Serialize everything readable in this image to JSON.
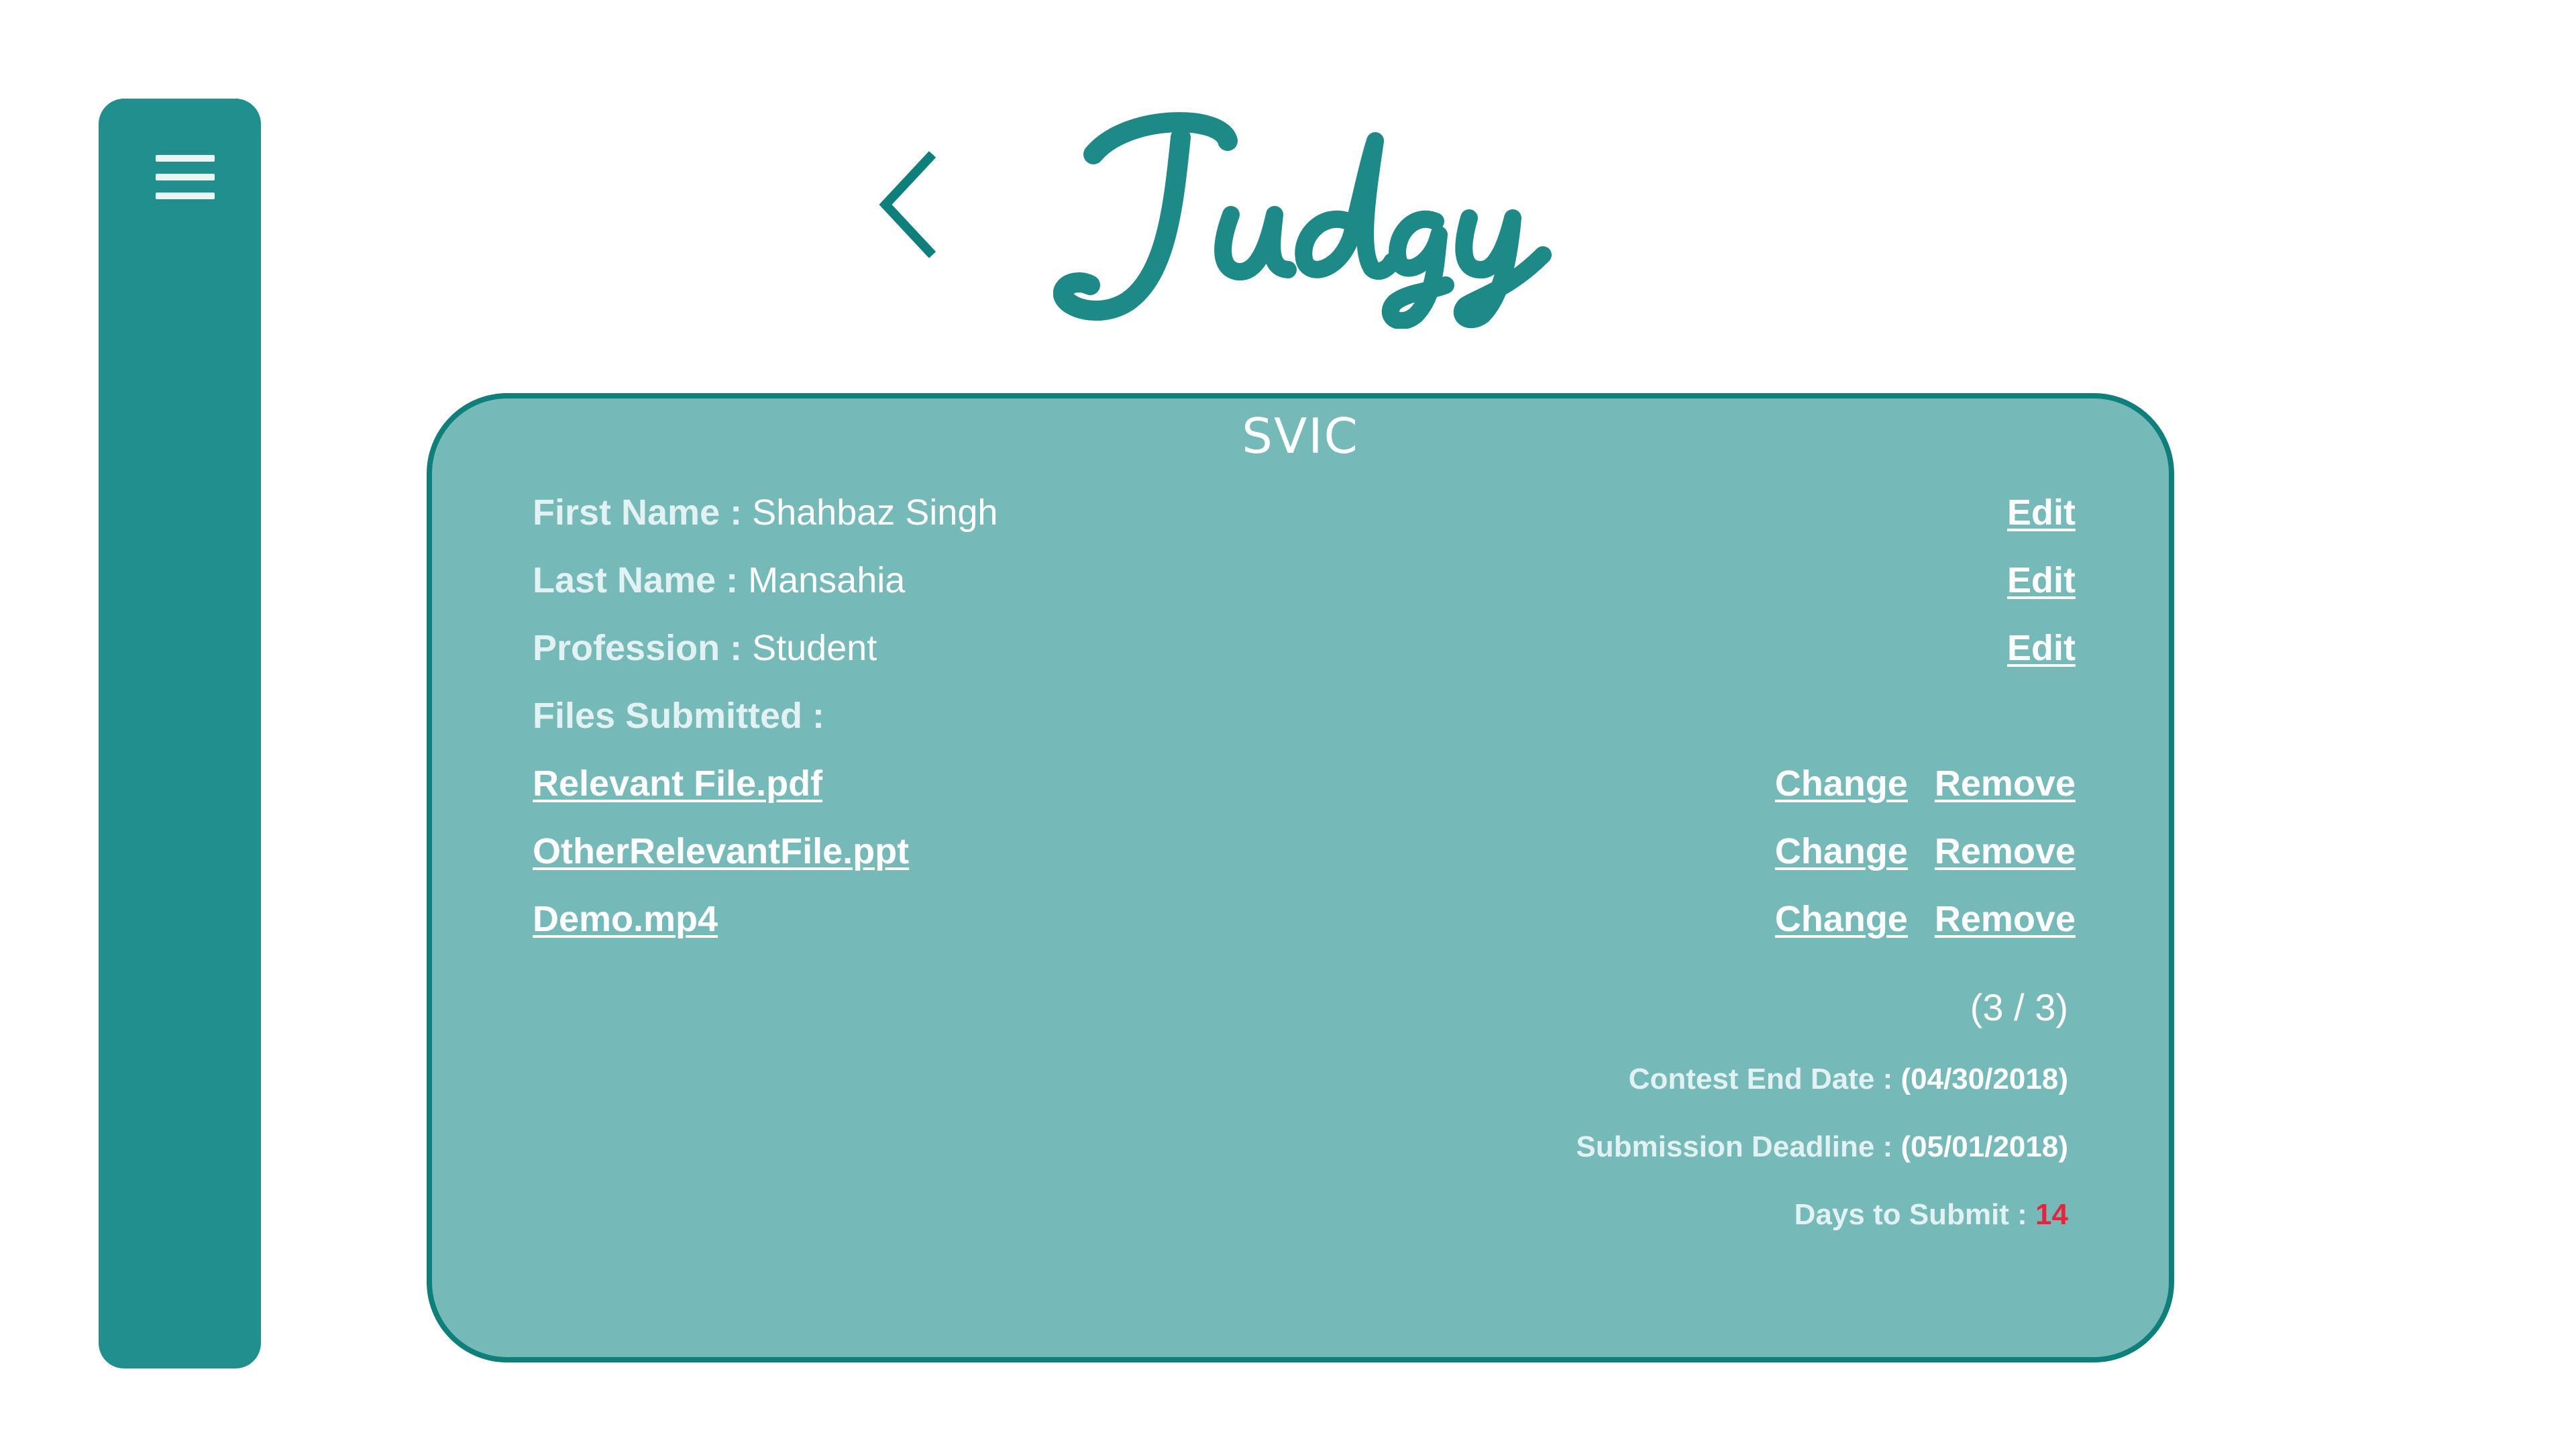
{
  "app": {
    "logo_text": "Judgy",
    "colors": {
      "primary": "#208f8e",
      "card_bg": "#75b9b8",
      "card_border": "#0f7f7c",
      "accent_red": "#e5253d"
    }
  },
  "header": {
    "back_icon": "chevron-left-icon",
    "menu_icon": "hamburger-menu-icon"
  },
  "card": {
    "title": "SVIC",
    "fields": [
      {
        "label": "First Name : ",
        "value": "Shahbaz Singh",
        "action": "Edit"
      },
      {
        "label": "Last Name : ",
        "value": "Mansahia",
        "action": "Edit"
      },
      {
        "label": "Profession : ",
        "value": "Student",
        "action": "Edit"
      }
    ],
    "files_label": "Files Submitted :",
    "files": [
      {
        "name": "Relevant File.pdf",
        "change": "Change",
        "remove": "Remove"
      },
      {
        "name": "OtherRelevantFile.ppt",
        "change": "Change",
        "remove": "Remove"
      },
      {
        "name": "Demo.mp4",
        "change": "Change",
        "remove": "Remove"
      }
    ],
    "file_count": "(3 / 3)",
    "contest_end_label": "Contest End Date : ",
    "contest_end_value": "(04/30/2018)",
    "deadline_label": "Submission Deadline : ",
    "deadline_value": "(05/01/2018)",
    "days_label": "Days to Submit : ",
    "days_value": "14"
  }
}
